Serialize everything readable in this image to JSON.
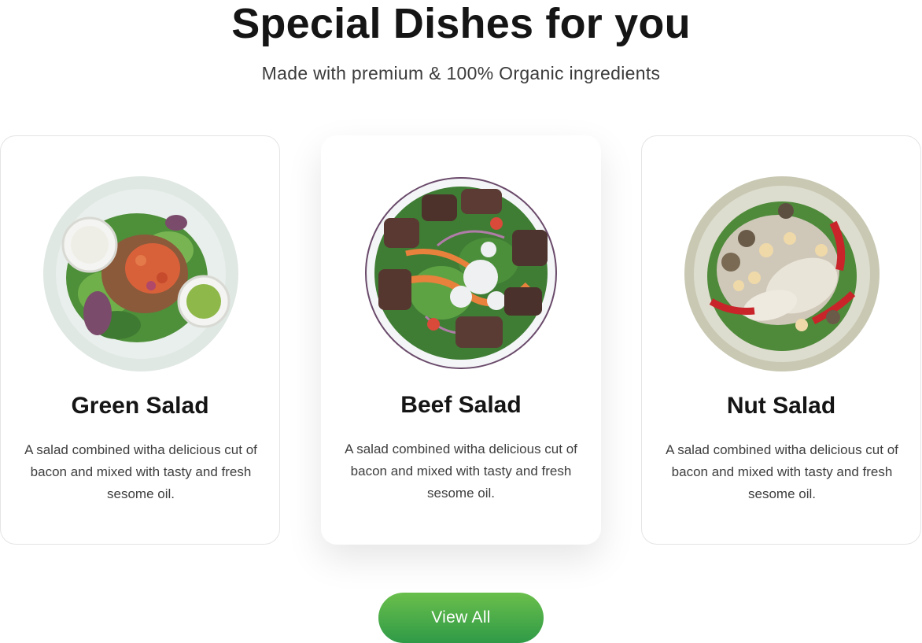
{
  "section": {
    "title": "Special Dishes for you",
    "subtitle": "Made with premium & 100% Organic ingredients"
  },
  "dishes": [
    {
      "name": "Green Salad",
      "description": "A salad combined witha delicious cut of bacon and mixed with tasty and fresh sesome oil.",
      "image_icon": "green-salad-bowl"
    },
    {
      "name": "Beef Salad",
      "description": "A salad combined witha delicious cut of bacon and mixed with tasty and fresh sesome oil.",
      "image_icon": "beef-salad-bowl"
    },
    {
      "name": "Nut Salad",
      "description": "A salad combined witha delicious cut of bacon and mixed with tasty and fresh sesome oil.",
      "image_icon": "nut-salad-bowl"
    }
  ],
  "actions": {
    "view_all_label": "View All"
  },
  "colors": {
    "button_top": "#6abf4b",
    "button_bottom": "#2f9a47",
    "text": "#151515"
  }
}
